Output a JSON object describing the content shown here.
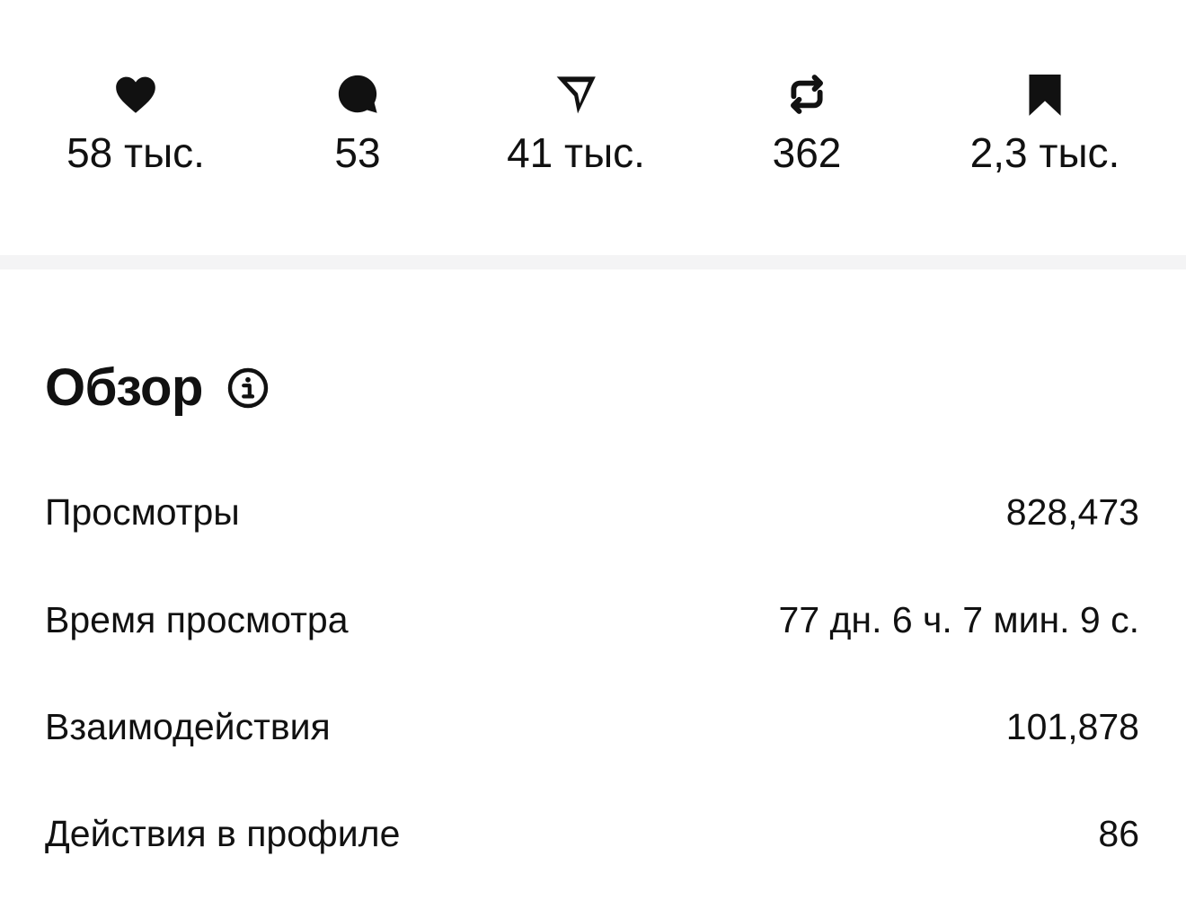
{
  "stats": [
    {
      "icon": "heart-icon",
      "value": "58 тыс."
    },
    {
      "icon": "comment-icon",
      "value": "53"
    },
    {
      "icon": "send-icon",
      "value": "41 тыс."
    },
    {
      "icon": "repost-icon",
      "value": "362"
    },
    {
      "icon": "bookmark-icon",
      "value": "2,3 тыс."
    }
  ],
  "overview": {
    "title": "Обзор",
    "info_icon": "info-icon",
    "metrics": [
      {
        "label": "Просмотры",
        "value": "828,473"
      },
      {
        "label": "Время просмотра",
        "value": "77 дн. 6 ч. 7 мин. 9 с."
      },
      {
        "label": "Взаимодействия",
        "value": "101,878"
      },
      {
        "label": "Действия в профиле",
        "value": "86"
      }
    ]
  },
  "colors": {
    "text": "#111111",
    "divider": "#f4f4f5",
    "background": "#ffffff"
  }
}
